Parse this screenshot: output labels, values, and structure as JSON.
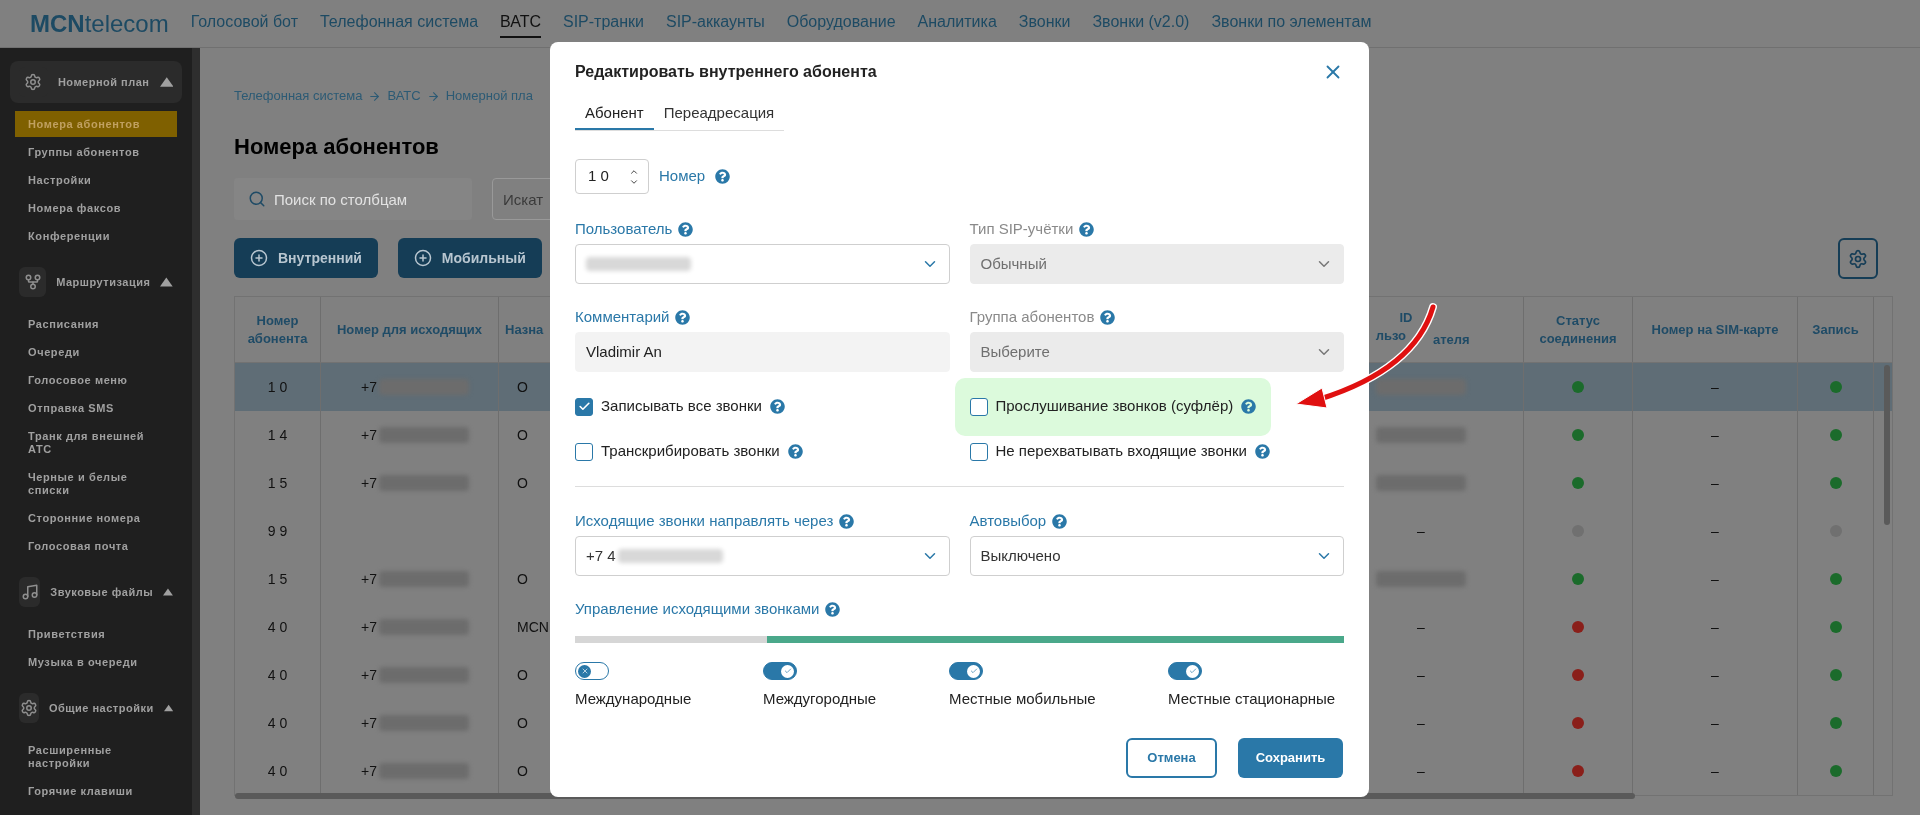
{
  "header": {
    "logo": "**MCN**telecom",
    "nav": [
      {
        "label": "Голосовой бот",
        "selected": false
      },
      {
        "label": "Телефонная система",
        "selected": false
      },
      {
        "label": "ВАТС",
        "selected": true
      },
      {
        "label": "SIP-транки",
        "selected": false
      },
      {
        "label": "SIP-аккаунты",
        "selected": false
      },
      {
        "label": "Оборудование",
        "selected": false
      },
      {
        "label": "Аналитика",
        "selected": false
      },
      {
        "label": "Звонки",
        "selected": false
      },
      {
        "label": "Звонки (v2.0)",
        "selected": false
      },
      {
        "label": "Звонки по элементам",
        "selected": false
      }
    ]
  },
  "sidebar": {
    "groups": [
      {
        "kind": "gear",
        "title": "Номерной план",
        "expanded": true,
        "items": [
          {
            "label": "Номера абонентов",
            "selected": true
          },
          {
            "label": "Группы абонентов",
            "selected": false
          },
          {
            "label": "Настройки",
            "selected": false
          },
          {
            "label": "Номера факсов",
            "selected": false
          },
          {
            "label": "Конференции",
            "selected": false
          }
        ]
      },
      {
        "kind": "branch",
        "title": "Маршрутизация",
        "expanded": true,
        "items": [
          {
            "label": "Расписания",
            "selected": false
          },
          {
            "label": "Очереди",
            "selected": false
          },
          {
            "label": "Голосовое меню",
            "selected": false
          },
          {
            "label": "Отправка SMS",
            "selected": false
          },
          {
            "label": "Транк для внешней АТС",
            "selected": false
          },
          {
            "label": "Черные и белые списки",
            "selected": false
          },
          {
            "label": "Сторонние номера",
            "selected": false
          },
          {
            "label": "Голосовая почта",
            "selected": false
          }
        ]
      },
      {
        "kind": "music",
        "title": "Звуковые файлы",
        "expanded": true,
        "items": [
          {
            "label": "Приветствия",
            "selected": false
          },
          {
            "label": "Музыка в очереди",
            "selected": false
          }
        ]
      },
      {
        "kind": "gear",
        "title": "Общие настройки",
        "expanded": true,
        "items": [
          {
            "label": "Расширенные настройки",
            "selected": false
          },
          {
            "label": "Горячие клавиши",
            "selected": false
          }
        ]
      }
    ]
  },
  "page": {
    "breadcrumbs": [
      "Телефонная система",
      "ВАТС",
      "Номерной пла"
    ],
    "title": "Номера абонентов",
    "search": {
      "placeholder": "Поиск по столбцам"
    },
    "filter": {
      "placeholder": "Искат"
    },
    "buttons": [
      "Внутренний",
      "Мобильный"
    ]
  },
  "table": {
    "columns": [
      "Номер абонента",
      "Номер для исходящих",
      "Назна",
      "ID",
      "льзо",
      "ателя",
      "Статус соединения",
      "Номер на SIM-карте",
      "Запись"
    ],
    "rows": [
      {
        "selected": true,
        "number": "1 0",
        "outgoing": "+7",
        "outgoing_blurred": true,
        "purpose": "О",
        "user_blurred": true,
        "status": {
          "color": "#1b6b2b"
        },
        "sim": "–",
        "record": {
          "color": "#1b6b2b"
        }
      },
      {
        "selected": false,
        "number": "1 4",
        "outgoing": "+7",
        "outgoing_blurred": true,
        "purpose": "О",
        "user_blurred": true,
        "status": {
          "color": "#1b6b2b"
        },
        "sim": "–",
        "record": {
          "color": "#1b6b2b"
        }
      },
      {
        "selected": false,
        "number": "1 5",
        "outgoing": "+7",
        "outgoing_blurred": true,
        "purpose": "О",
        "user_blurred": true,
        "status": {
          "color": "#1b6b2b"
        },
        "sim": "–",
        "record": {
          "color": "#1b6b2b"
        }
      },
      {
        "selected": false,
        "number": "9 9",
        "outgoing_blurred": false,
        "user": "–",
        "user_blurred": false,
        "status": {
          "color": "#707070"
        },
        "sim": "–",
        "record": {
          "color": "#707070"
        }
      },
      {
        "selected": false,
        "number": "1 5",
        "outgoing": "+7",
        "outgoing_blurred": true,
        "purpose": "О",
        "user_blurred": true,
        "status": {
          "color": "#1b6b2b"
        },
        "sim": "–",
        "record": {
          "color": "#1b6b2b"
        }
      },
      {
        "selected": false,
        "number": "4 0",
        "outgoing": "+7",
        "outgoing_blurred": true,
        "purpose": "MCN",
        "user": "–",
        "user_blurred": false,
        "status": {
          "color": "#8a1f1a"
        },
        "sim": "–",
        "record": {
          "color": "#1b6b2b"
        }
      },
      {
        "selected": false,
        "number": "4 0",
        "outgoing": "+7",
        "outgoing_blurred": true,
        "purpose": "О",
        "user": "–",
        "user_blurred": false,
        "status": {
          "color": "#8a1f1a"
        },
        "sim": "–",
        "record": {
          "color": "#1b6b2b"
        }
      },
      {
        "selected": false,
        "number": "4 0",
        "outgoing": "+7",
        "outgoing_blurred": true,
        "purpose": "О",
        "user": "–",
        "user_blurred": false,
        "status": {
          "color": "#8a1f1a"
        },
        "sim": "–",
        "record": {
          "color": "#1b6b2b"
        }
      },
      {
        "selected": false,
        "number": "4 0",
        "outgoing": "+7",
        "outgoing_blurred": true,
        "purpose": "О",
        "user": "–",
        "user_blurred": false,
        "status": {
          "color": "#8a1f1a"
        },
        "sim": "–",
        "record": {
          "color": "#1b6b2b"
        }
      }
    ]
  },
  "modal": {
    "title": "Редактировать внутреннего абонента",
    "tabs": [
      {
        "label": "Абонент",
        "selected": true
      },
      {
        "label": "Переадресация",
        "selected": false
      }
    ],
    "number": {
      "value": "1 0",
      "label": "Номер"
    },
    "fields": [
      {
        "label": "Пользователь",
        "kind": "select",
        "blurred": true,
        "disabled": false
      },
      {
        "label": "Тип SIP-учётки",
        "kind": "select",
        "value": "Обычный",
        "blurred": false,
        "disabled": true
      },
      {
        "label": "Комментарий",
        "kind": "input",
        "value": "Vladimir An",
        "blurred": false,
        "disabled": false
      },
      {
        "label": "Группа абонентов",
        "kind": "select",
        "value": "Выберите",
        "blurred": false,
        "disabled": true
      }
    ],
    "checkboxes": [
      {
        "label": "Записывать все звонки",
        "checked": true,
        "highlighted": false
      },
      {
        "label": "Прослушивание звонков (суфлёр)",
        "checked": false,
        "highlighted": true
      },
      {
        "label": "Транскрибировать звонки",
        "checked": false,
        "highlighted": false
      },
      {
        "label": "Не перехватывать входящие звонки",
        "checked": false,
        "highlighted": false
      }
    ],
    "routing": [
      {
        "label": "Исходящие звонки направлять через",
        "value": "+7 4",
        "blurred": true
      },
      {
        "label": "Автовыбор",
        "value": "Выключено",
        "blurred": false
      }
    ],
    "control": {
      "label": "Управление исходящими звонками",
      "level": 0.75,
      "toggles": [
        {
          "label": "Международные",
          "on": false
        },
        {
          "label": "Междугородные",
          "on": true
        },
        {
          "label": "Местные мобильные",
          "on": true
        },
        {
          "label": "Местные стационарные",
          "on": true
        }
      ]
    },
    "buttons": {
      "cancel": "Отмена",
      "save": "Сохранить"
    }
  }
}
